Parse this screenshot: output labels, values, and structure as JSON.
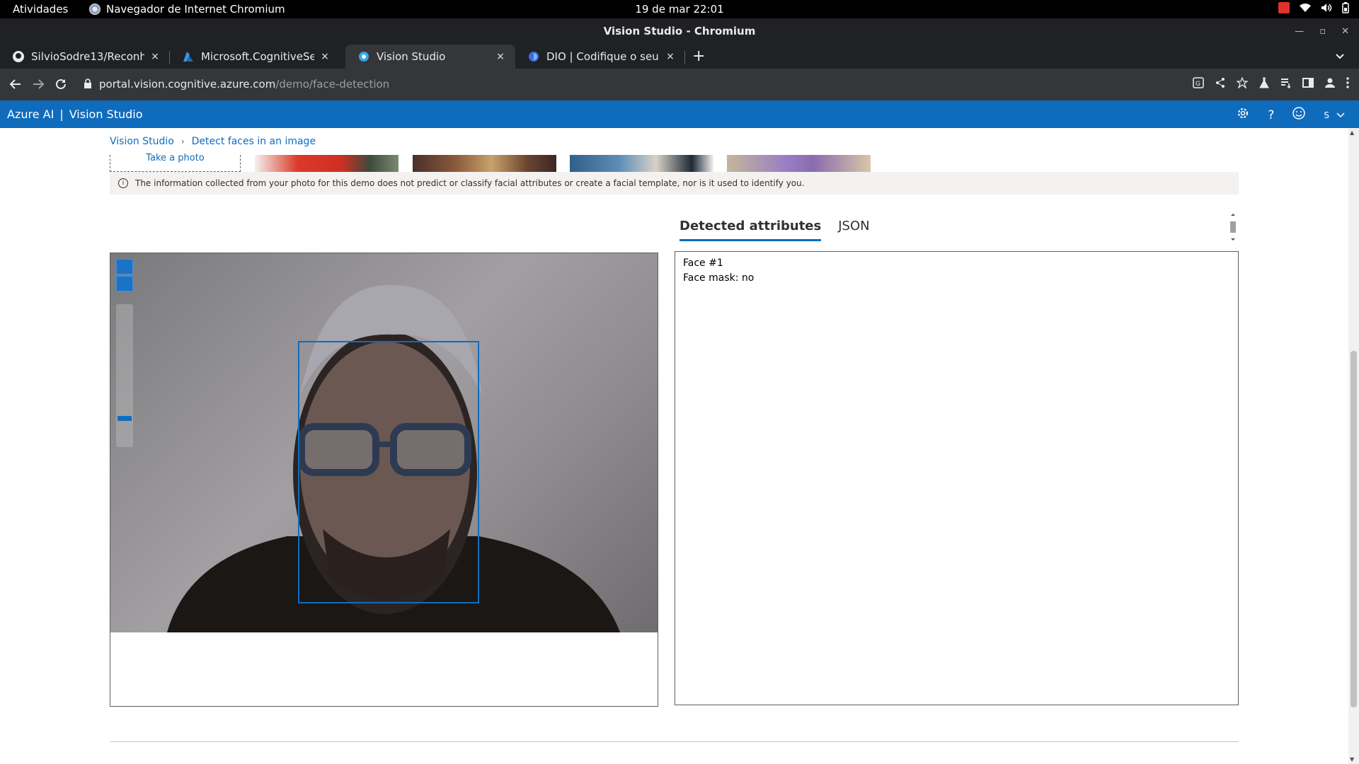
{
  "os_bar": {
    "activities": "Atividades",
    "app_name": "Navegador de Internet Chromium",
    "clock": "19 de mar  22:01"
  },
  "window": {
    "title": "Vision Studio - Chromium"
  },
  "tabs": [
    {
      "title": "SilvioSodre13/Reconheci",
      "icon": "github-icon"
    },
    {
      "title": "Microsoft.CognitiveServi",
      "icon": "azure-icon"
    },
    {
      "title": "Vision Studio",
      "icon": "vision-studio-icon"
    },
    {
      "title": "DIO | Codifique o seu futu",
      "icon": "dio-icon"
    }
  ],
  "tab_close": "×",
  "new_tab": "+",
  "address": {
    "host": "portal.vision.cognitive.azure.com",
    "path": "/demo/face-detection"
  },
  "azure_header": {
    "brand": "Azure AI",
    "separator": "|",
    "product": "Vision Studio",
    "user_initial": "S"
  },
  "breadcrumb": {
    "root": "Vision Studio",
    "current": "Detect faces in an image"
  },
  "take_photo": "Take a photo",
  "info_text": "The information collected from your photo for this demo does not predict or classify facial attributes or create a facial template, nor is it used to identify you.",
  "result_tabs": {
    "attributes": "Detected attributes",
    "json": "JSON"
  },
  "results": {
    "face": "Face #1",
    "mask": "Face mask: no"
  }
}
